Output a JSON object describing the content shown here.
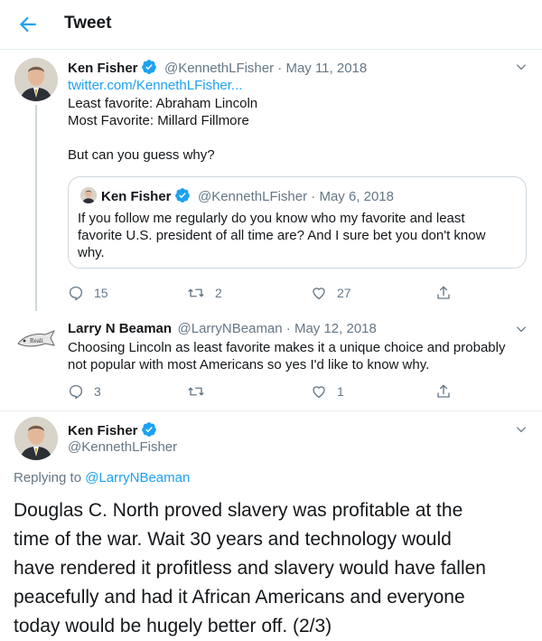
{
  "header": {
    "title": "Tweet"
  },
  "tweet1": {
    "name": "Ken Fisher",
    "handle_date": "@KennethLFisher · May 11, 2018",
    "link": "twitter.com/KennethLFisher...",
    "line1": "Least favorite: Abraham Lincoln",
    "line2": "Most Favorite: Millard Fillmore",
    "line3": "But can you guess why?",
    "quote": {
      "name": "Ken Fisher",
      "handle_date": "@KennethLFisher · May 6, 2018",
      "line1": "If you follow me regularly do you know who my favorite and least",
      "line2": "favorite U.S. president of all time are? And I sure bet you don't know",
      "line3": "why."
    },
    "replies": "15",
    "retweets": "2",
    "likes": "27"
  },
  "tweet2": {
    "name": "Larry N Beaman",
    "handle_date": "@LarryNBeaman · May 12, 2018",
    "line1": "Choosing Lincoln as least favorite makes it a unique choice and probably",
    "line2": "not popular with most Americans so yes I'd like to know why.",
    "replies": "3",
    "retweets": "",
    "likes": "1",
    "avatar_text": "Reali"
  },
  "main": {
    "name": "Ken Fisher",
    "handle": "@KennethLFisher",
    "replying_prefix": "Replying to",
    "replying_to": "@LarryNBeaman",
    "line1": "Douglas C. North proved slavery was profitable at the",
    "line2": "time of the war. Wait 30 years and technology would",
    "line3": "have rendered it profitless and slavery would have fallen",
    "line4": "peacefully and had it African Americans and everyone",
    "line5": "today would be hugely better off. (2/3)"
  },
  "colors": {
    "accent": "#1da1f2",
    "secondary": "#657786",
    "border": "#e6ecf0"
  },
  "icons": [
    "back-arrow-icon",
    "verified-icon",
    "chevron-down-icon",
    "reply-icon",
    "retweet-icon",
    "like-icon",
    "share-icon"
  ]
}
